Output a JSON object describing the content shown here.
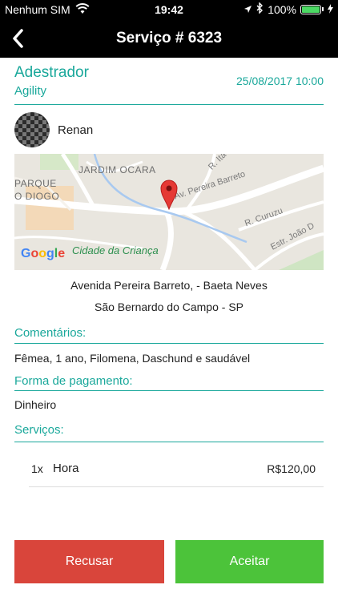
{
  "status_bar": {
    "carrier": "Nenhum SIM",
    "time": "19:42",
    "battery": "100%"
  },
  "nav": {
    "title": "Serviço # 6323"
  },
  "service": {
    "name": "Adestrador",
    "subtitle": "Agility",
    "datetime": "25/08/2017 10:00"
  },
  "client": {
    "name": "Renan"
  },
  "map": {
    "labels": {
      "jardim": "JARDIM OCARA",
      "parque": "PARQUE",
      "diogo": "O DIOGO",
      "pereira": "Av. Pereira Barreto",
      "cruzu": "R. Curuzu",
      "joao": "Estr. João D",
      "ita": "R. Ita",
      "cidade": "Cidade da Criança"
    },
    "google_logo": "Google"
  },
  "address": {
    "line1": "Avenida Pereira Barreto, - Baeta Neves",
    "line2": "São Bernardo do Campo - SP"
  },
  "comments": {
    "label": "Comentários:",
    "value": "Fêmea, 1 ano, Filomena, Daschund e saudável"
  },
  "payment": {
    "label": "Forma de pagamento:",
    "value": "Dinheiro"
  },
  "services": {
    "label": "Serviços:",
    "items": [
      {
        "qty": "1x",
        "name": "Hora",
        "price": "R$120,00"
      }
    ]
  },
  "actions": {
    "reject": "Recusar",
    "accept": "Aceitar"
  },
  "colors": {
    "accent": "#1aa89b",
    "reject": "#d9453b",
    "accept": "#4cc33a"
  }
}
